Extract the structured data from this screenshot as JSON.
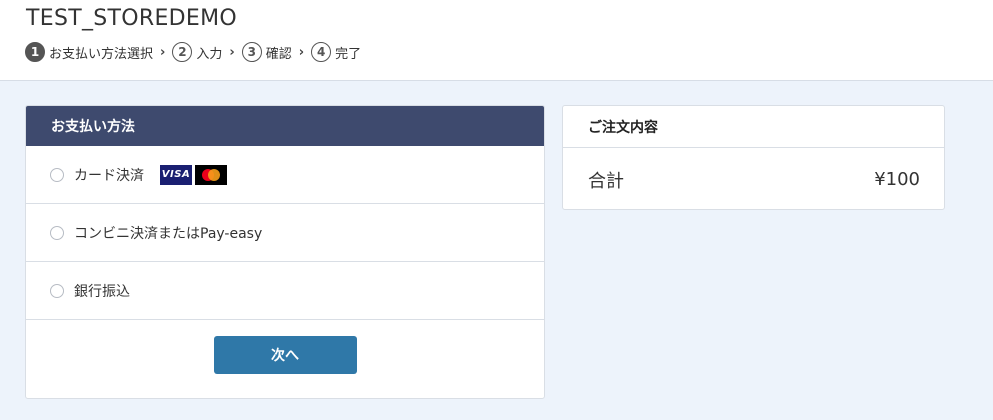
{
  "store": {
    "title": "TEST_STOREDEMO"
  },
  "steps": [
    {
      "num": "1",
      "label": "お支払い方法選択",
      "active": true
    },
    {
      "num": "2",
      "label": "入力",
      "active": false
    },
    {
      "num": "3",
      "label": "確認",
      "active": false
    },
    {
      "num": "4",
      "label": "完了",
      "active": false
    }
  ],
  "payment": {
    "heading": "お支払い方法",
    "options": [
      {
        "label": "カード決済",
        "logos": [
          "visa-logo",
          "mastercard-logo"
        ],
        "selected": false
      },
      {
        "label": "コンビニ決済またはPay-easy",
        "selected": false
      },
      {
        "label": "銀行振込",
        "selected": false
      }
    ],
    "visa_text": "VISA",
    "next_label": "次へ",
    "next_color": "#2f78a8",
    "header_color": "#3e4a6e"
  },
  "order": {
    "heading": "ご注文内容",
    "total_label": "合計",
    "total_value": "¥100"
  }
}
